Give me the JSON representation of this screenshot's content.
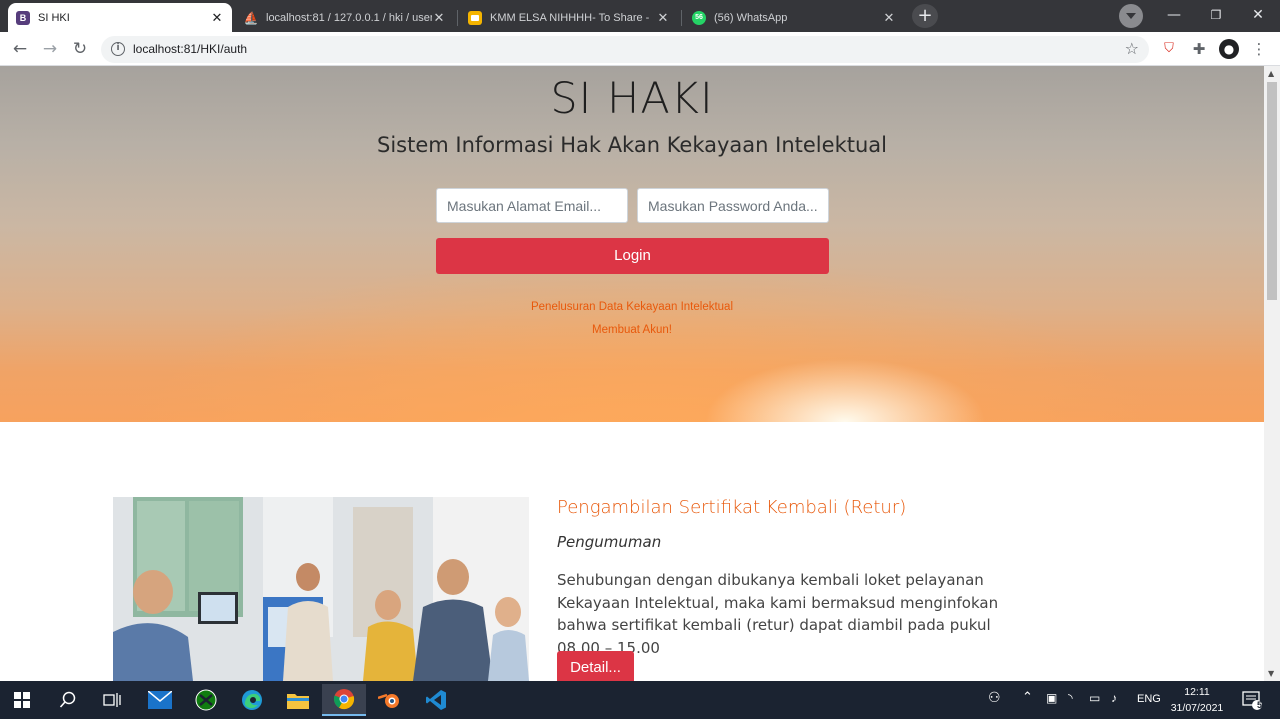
{
  "browser": {
    "tabs": [
      {
        "title": "SI HKI",
        "favicon": "B",
        "favicon_color": "#563d7c",
        "active": true
      },
      {
        "title": "localhost:81 / 127.0.0.1 / hki / user",
        "favicon": "pma",
        "favicon_color": "#f29111",
        "active": false
      },
      {
        "title": "KMM ELSA NIHHHH- To Share - ",
        "favicon": "slides",
        "favicon_color": "#f4b400",
        "active": false
      },
      {
        "title": "(56) WhatsApp",
        "favicon": "56",
        "favicon_color": "#25d366",
        "active": false
      }
    ],
    "url": "localhost:81/HKI/auth"
  },
  "hero": {
    "title": "SI HAKI",
    "subtitle": "Sistem Informasi Hak Akan Kekayaan Intelektual",
    "email_placeholder": "Masukan Alamat Email...",
    "password_placeholder": "Masukan Password Anda...",
    "login_label": "Login",
    "search_link": "Penelusuran Data Kekayaan Intelektual",
    "register_link": "Membuat Akun!"
  },
  "article": {
    "title": "Pengambilan Sertifikat Kembali (Retur)",
    "category": "Pengumuman",
    "body": "Sehubungan dengan dibukanya kembali loket pelayanan Kekayaan Intelektual, maka kami bermaksud menginfokan bahwa sertifikat kembali (retur) dapat diambil pada pukul 08.00 – 15.00",
    "detail_label": "Detail..."
  },
  "taskbar": {
    "language": "ENG",
    "time": "12:11",
    "date": "31/07/2021",
    "notification_count": "5"
  },
  "colors": {
    "primary_red": "#dc3545",
    "link_orange": "#e8590c",
    "taskbar_bg": "#1b2331"
  }
}
